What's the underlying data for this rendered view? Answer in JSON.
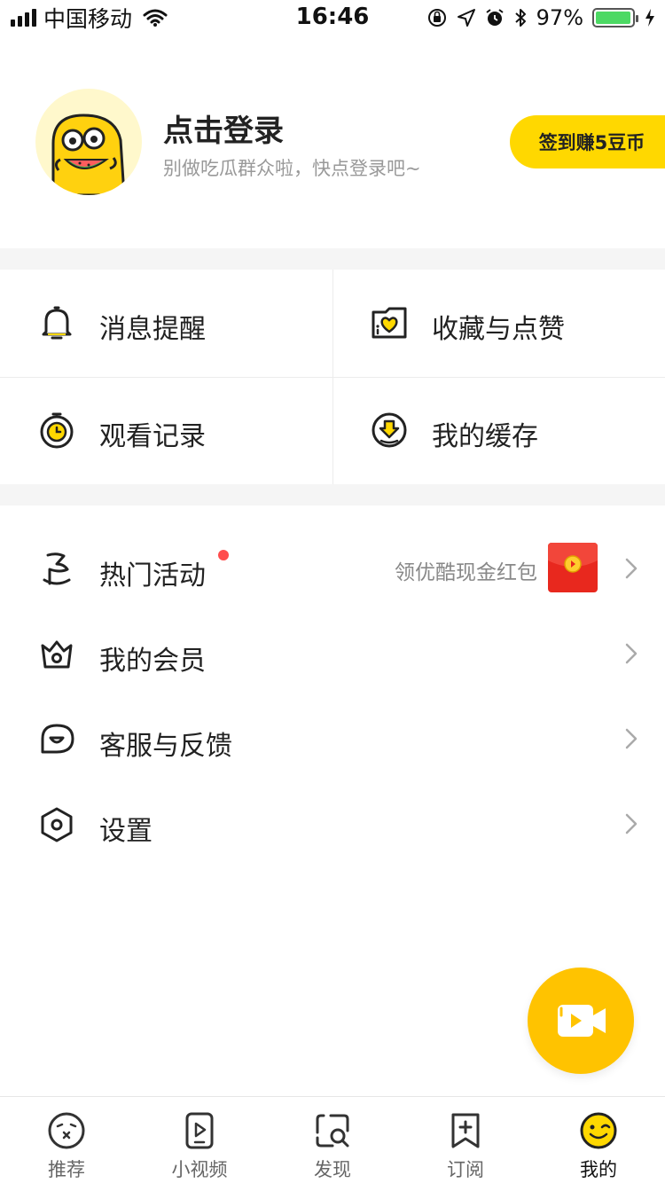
{
  "status_bar": {
    "carrier": "中国移动",
    "time": "16:46",
    "battery_percent": "97%",
    "battery_level": 0.97
  },
  "profile": {
    "title": "点击登录",
    "subtitle": "别做吃瓜群众啦，快点登录吧~",
    "checkin_label": "签到赚5豆币"
  },
  "grid": {
    "items": [
      {
        "label": "消息提醒",
        "icon": "bell-icon"
      },
      {
        "label": "收藏与点赞",
        "icon": "heart-folder-icon"
      },
      {
        "label": "观看记录",
        "icon": "stopwatch-icon"
      },
      {
        "label": "我的缓存",
        "icon": "download-icon"
      }
    ]
  },
  "menu": {
    "items": [
      {
        "label": "热门活动",
        "icon": "flag-icon",
        "desc": "领优酷现金红包",
        "has_dot": true
      },
      {
        "label": "我的会员",
        "icon": "crown-icon"
      },
      {
        "label": "客服与反馈",
        "icon": "chat-icon"
      },
      {
        "label": "设置",
        "icon": "hexagon-settings-icon"
      }
    ]
  },
  "fab": {
    "icon": "video-camera-icon"
  },
  "tabs": [
    {
      "label": "推荐",
      "icon": "face-icon",
      "active": false
    },
    {
      "label": "小视频",
      "icon": "phone-play-icon",
      "active": false
    },
    {
      "label": "发现",
      "icon": "search-frame-icon",
      "active": false
    },
    {
      "label": "订阅",
      "icon": "bookmark-plus-icon",
      "active": false
    },
    {
      "label": "我的",
      "icon": "wink-face-icon",
      "active": true
    }
  ],
  "colors": {
    "accent": "#ffd800",
    "fab": "#ffc300",
    "dot": "#ff4d4d",
    "battery": "#4cd964"
  }
}
